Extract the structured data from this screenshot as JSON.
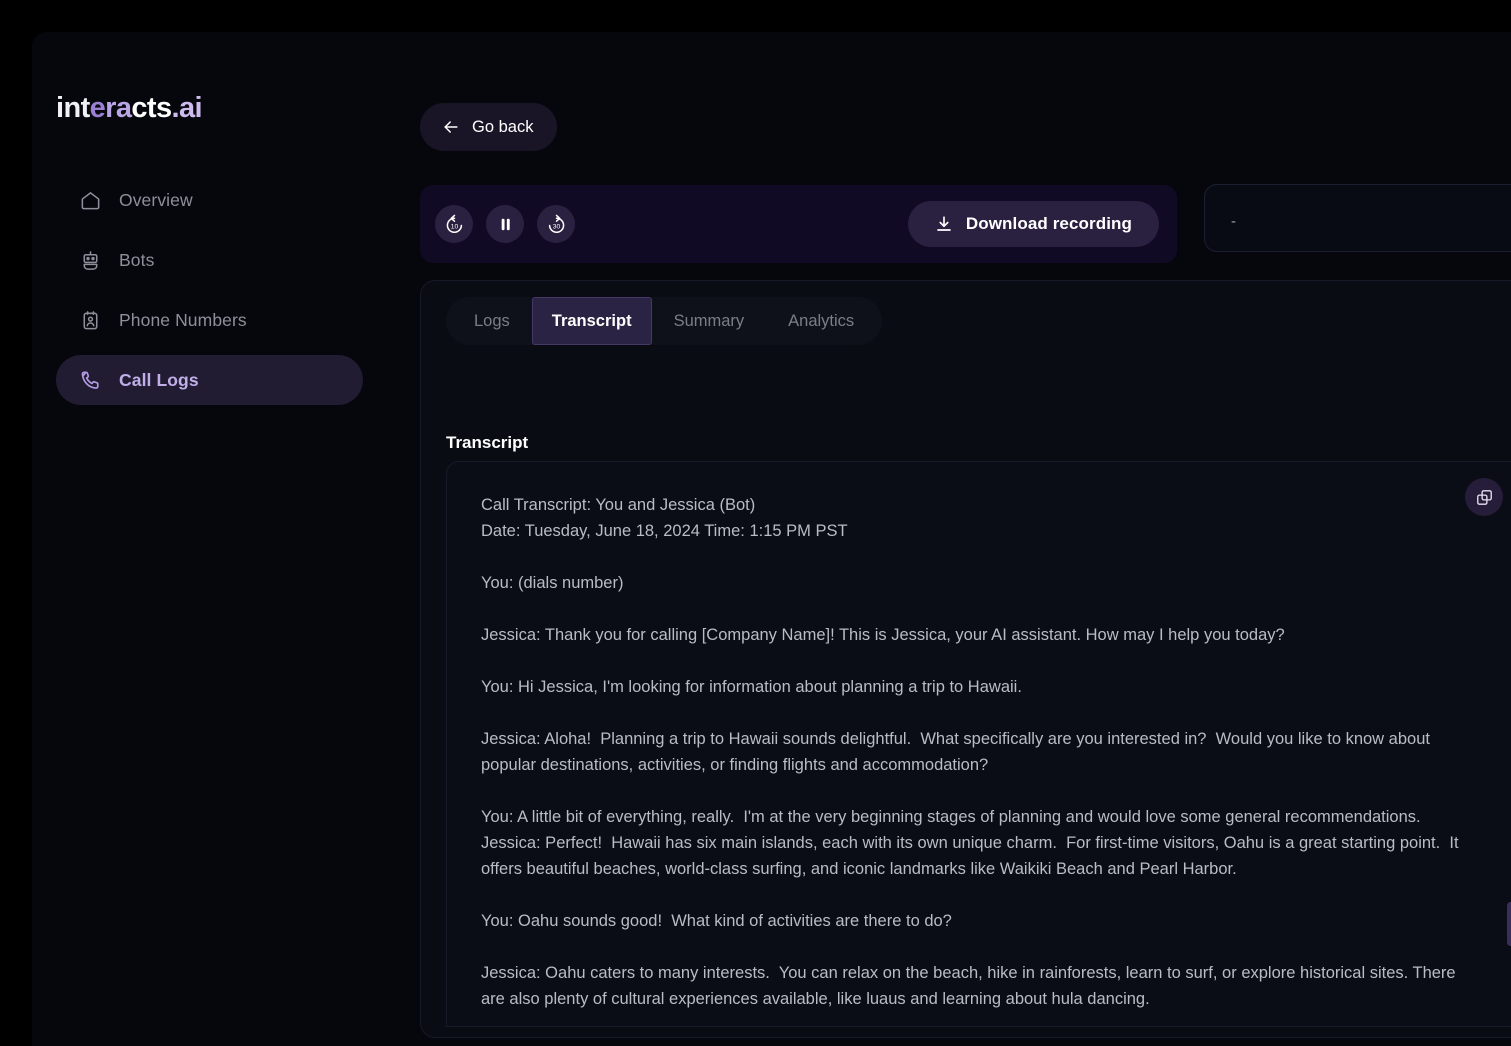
{
  "brand": {
    "logo_part1": "int",
    "logo_part2": "e",
    "logo_part3": "ra",
    "logo_part4": "cts",
    "logo_part5": ".ai"
  },
  "sidebar": {
    "items": [
      {
        "label": "Overview",
        "icon": "home-icon",
        "active": false
      },
      {
        "label": "Bots",
        "icon": "robot-icon",
        "active": false
      },
      {
        "label": "Phone Numbers",
        "icon": "contact-card-icon",
        "active": false
      },
      {
        "label": "Call Logs",
        "icon": "phone-icon",
        "active": true
      }
    ]
  },
  "toolbar": {
    "go_back_label": "Go back"
  },
  "player": {
    "rewind_label": "10",
    "forward_label": "30",
    "download_label": "Download recording"
  },
  "side_panel": {
    "value": "-"
  },
  "card": {
    "tabs": [
      {
        "label": "Logs",
        "active": false
      },
      {
        "label": "Transcript",
        "active": true
      },
      {
        "label": "Summary",
        "active": false
      },
      {
        "label": "Analytics",
        "active": false
      }
    ],
    "title": "Transcript"
  },
  "transcript": {
    "header_line1": "Call Transcript: You and Jessica (Bot)",
    "header_line2": "Date: Tuesday, June 18, 2024 Time: 1:15 PM PST",
    "line_you_dials": "You: (dials number)",
    "line_jessica_greeting": "Jessica: Thank you for calling [Company Name]! This is Jessica, your AI assistant. How may I help you today?",
    "line_you_hawaii": "You: Hi Jessica, I'm looking for information about planning a trip to Hawaii.",
    "line_jessica_aloha": "Jessica: Aloha!  Planning a trip to Hawaii sounds delightful.  What specifically are you interested in?  Would you like to know about popular destinations, activities, or finding flights and accommodation?",
    "line_you_everything": "You: A little bit of everything, really.  I'm at the very beginning stages of planning and would love some general recommendations.\nJessica: Perfect!  Hawaii has six main islands, each with its own unique charm.  For first-time visitors, Oahu is a great starting point.  It offers beautiful beaches, world-class surfing, and iconic landmarks like Waikiki Beach and Pearl Harbor.",
    "line_you_oahu": "You: Oahu sounds good!  What kind of activities are there to do?",
    "line_jessica_oahu": "Jessica: Oahu caters to many interests.  You can relax on the beach, hike in rainforests, learn to surf, or explore historical sites. There are also plenty of cultural experiences available, like luaus and learning about hula dancing.",
    "copy_icon": "copy-icon"
  }
}
